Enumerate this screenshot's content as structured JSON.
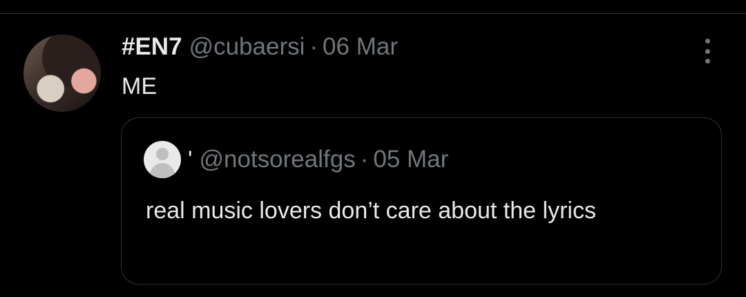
{
  "tweet": {
    "display_name": "#EN7",
    "handle": "@cubaersi",
    "separator": "·",
    "date": "06 Mar",
    "text": "ME",
    "more_icon": "more-vertical-icon"
  },
  "quote": {
    "display_name": "'",
    "handle": "@notsorealfgs",
    "separator": "·",
    "date": "05 Mar",
    "text": "real music lovers don’t care about the lyrics",
    "avatar_icon": "default-profile-icon"
  },
  "colors": {
    "background": "#000000",
    "primary_text": "#e7e9ea",
    "secondary_text": "#71767b",
    "border": "#2f3336"
  }
}
